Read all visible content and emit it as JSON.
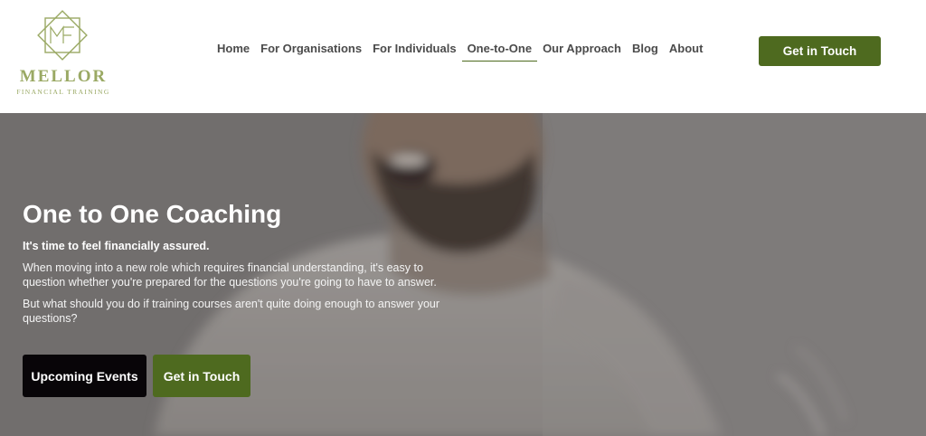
{
  "brand": {
    "name": "MELLOR",
    "subtitle": "FINANCIAL TRAINING",
    "logo_icon": "mf-monogram-icon",
    "accent_color": "#4e6a1f",
    "logo_color": "#9aa964"
  },
  "nav": {
    "items": [
      {
        "label": "Home",
        "active": false
      },
      {
        "label": "For Organisations",
        "active": false
      },
      {
        "label": "For Individuals",
        "active": false
      },
      {
        "label": "One-to-One",
        "active": true
      },
      {
        "label": "Our Approach",
        "active": false
      },
      {
        "label": "Blog",
        "active": false
      },
      {
        "label": "About",
        "active": false
      }
    ],
    "cta_label": "Get in Touch"
  },
  "hero": {
    "title": "One to One Coaching",
    "tagline": "It's time to feel financially assured.",
    "paragraph_1": "When moving into a new role which requires financial understanding, it's easy to question whether you're prepared for the questions you're going to have to answer.",
    "paragraph_2": "But what should you do if training courses aren't quite doing enough to answer your questions?",
    "button_primary": "Upcoming Events",
    "button_secondary": "Get in Touch",
    "primary_color": "#080508",
    "secondary_color": "#4e6a1f"
  }
}
